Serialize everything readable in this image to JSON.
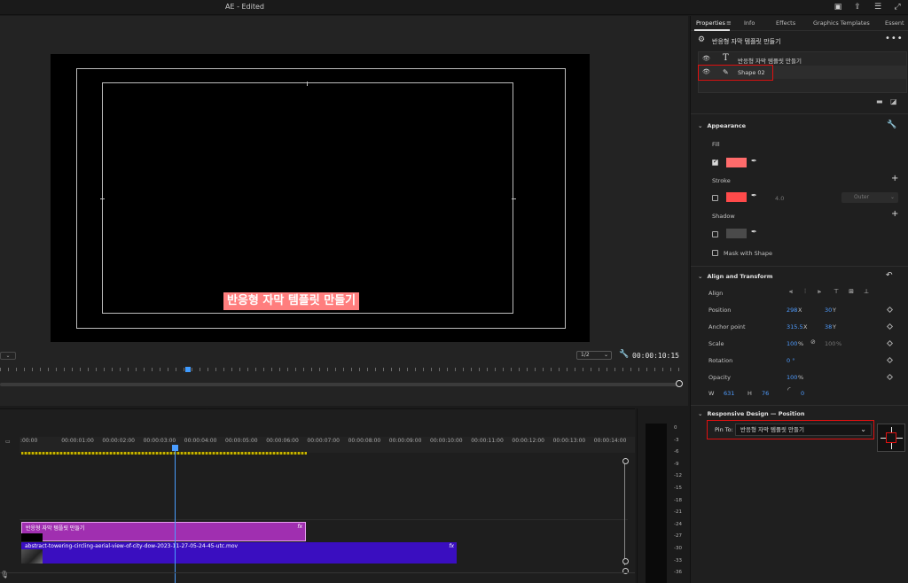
{
  "window": {
    "title": "AE - Edited"
  },
  "program_monitor": {
    "caption_text": "반응형 자막 템플릿 만들기",
    "resolution": "1/2",
    "timecode": "00:00:10:15",
    "caption_color": "#ff7e7e"
  },
  "timeline": {
    "ruler_labels": [
      ":00:00",
      "00:00:01:00",
      "00:00:02:00",
      "00:00:03:00",
      "00:00:04:00",
      "00:00:05:00",
      "00:00:06:00",
      "00:00:07:00",
      "00:00:08:00",
      "00:00:09:00",
      "00:00:10:00",
      "00:00:11:00",
      "00:00:12:00",
      "00:00:13:00",
      "00:00:14:00"
    ],
    "clips": {
      "title_clip": {
        "label": "반응형 자막 템플릿 만들기",
        "fx": "fx",
        "color": "#a02fb0"
      },
      "video_clip": {
        "label": "abstract-towering-circling-aerial-view-of-city-dow-2023-11-27-05-24-45-utc.mov",
        "fx": "fx",
        "color": "#3a0ec0"
      }
    }
  },
  "audio_meter": {
    "db_scale": [
      "0",
      "-3",
      "-6",
      "-9",
      "-12",
      "-15",
      "-18",
      "-21",
      "-24",
      "-27",
      "-30",
      "-33",
      "-36"
    ]
  },
  "properties": {
    "tabs": [
      "Properties",
      "Info",
      "Effects",
      "Graphics Templates",
      "Essent"
    ],
    "graphic_name": "반응형 자막 템플릿 만들기",
    "layers": [
      {
        "name": "반응형 자막 템플릿 만들기",
        "kind": "T"
      },
      {
        "name": "Shape 02",
        "kind": "pen"
      }
    ],
    "appearance": {
      "heading": "Appearance",
      "fill": {
        "label": "Fill",
        "color": "#ff6b6b",
        "checked": true
      },
      "stroke": {
        "label": "Stroke",
        "color": "#ff4a4a",
        "width": "4.0",
        "style": "Outer"
      },
      "shadow": {
        "label": "Shadow",
        "color": "#4a4a4a"
      },
      "mask_label": "Mask with Shape"
    },
    "align_transform": {
      "heading": "Align and Transform",
      "align_label": "Align",
      "position": {
        "label": "Position",
        "x": "298",
        "x_unit": "X",
        "y": "30",
        "y_unit": "Y"
      },
      "anchor": {
        "label": "Anchor point",
        "x": "315.5",
        "x_unit": "X",
        "y": "38",
        "y_unit": "Y"
      },
      "scale": {
        "label": "Scale",
        "value": "100",
        "unit": "%",
        "linked_value": "100",
        "linked_unit": "%"
      },
      "rotation": {
        "label": "Rotation",
        "value": "0 °"
      },
      "opacity": {
        "label": "Opacity",
        "value": "100",
        "unit": "%"
      },
      "size": {
        "w_label": "W",
        "w": "631",
        "h_label": "H",
        "h": "76",
        "radius": "0"
      }
    },
    "responsive": {
      "heading": "Responsive Design — Position",
      "pin_label": "Pin To:",
      "pin_value": "반응형 자막 템플릿 만들기"
    }
  }
}
